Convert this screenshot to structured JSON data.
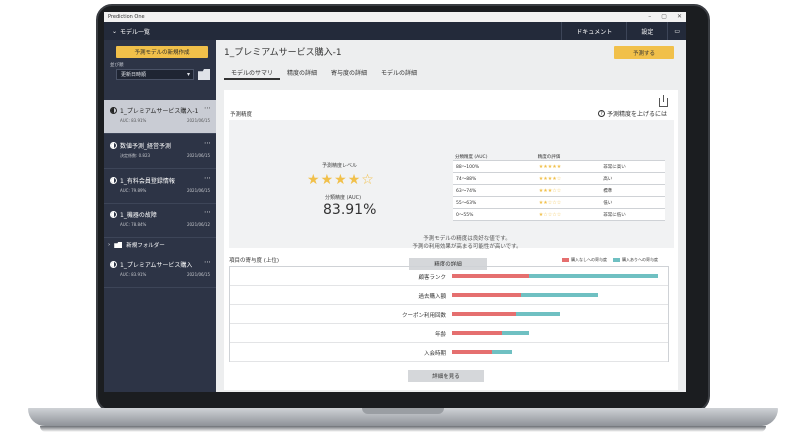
{
  "app": {
    "title": "Prediction One",
    "window_controls": [
      "–",
      "▢",
      "✕"
    ]
  },
  "menubar": {
    "models_label": "モデル一覧",
    "items": [
      "ドキュメント",
      "設定"
    ]
  },
  "sidebar": {
    "new_button": "予測モデルの新規作成",
    "sort_label": "並び順",
    "sort_value": "更新日時順",
    "models": [
      {
        "name": "1_プレミアムサービス購入-1",
        "auc": "AUC: 83.91%",
        "date": "2021/06/15"
      },
      {
        "name": "数値予測_経営予測",
        "auc": "決定係数: 0.823",
        "date": "2021/06/15"
      },
      {
        "name": "1_有料会員登録情報",
        "auc": "AUC: 79.89%",
        "date": "2021/06/15"
      },
      {
        "name": "1_機器の故障",
        "auc": "AUC: 78.84%",
        "date": "2021/06/12"
      }
    ],
    "folder_label": "新規フォルダー",
    "folder_model": {
      "name": "1_プレミアムサービス購入",
      "auc": "AUC: 83.91%",
      "date": "2021/06/15"
    }
  },
  "main": {
    "title": "1_プレミアムサービス購入-1",
    "predict_button": "予測する",
    "tabs": [
      "モデルのサマリ",
      "精度の詳細",
      "寄与度の詳細",
      "モデルの詳細"
    ],
    "accuracy_section": "予測精度",
    "help_link": "予測精度を上げるには",
    "level_label": "予測精度レベル",
    "stars_filled": 4,
    "stars_total": 5,
    "auc_label": "分類精度 (AUC)",
    "auc_value": "83.91%",
    "table": {
      "headers": [
        "分類精度 (AUC)",
        "精度の評価"
      ],
      "rows": [
        {
          "range": "88〜100%",
          "stars": "★★★★★",
          "desc": "非常に高い"
        },
        {
          "range": "74〜88%",
          "stars": "★★★★☆",
          "desc": "高い"
        },
        {
          "range": "63〜74%",
          "stars": "★★★☆☆",
          "desc": "標準"
        },
        {
          "range": "55〜63%",
          "stars": "★★☆☆☆",
          "desc": "低い"
        },
        {
          "range": "0〜55%",
          "stars": "★☆☆☆☆",
          "desc": "非常に低い"
        }
      ]
    },
    "note_line1": "予測モデルの精度は良好な値です。",
    "note_line2": "予測の利用効果が高まる可能性が高いです。",
    "detail_button": "精度の詳細",
    "contrib_title": "項目の寄与度 (上位)",
    "legend": {
      "negative": "購入なしへの寄与度",
      "positive": "購入ありへの寄与度",
      "neg_color": "#e56f6f",
      "pos_color": "#6fc0c2"
    },
    "contributions": [
      {
        "label": "顧客ランク",
        "neg": 0.37,
        "pos": 0.62
      },
      {
        "label": "過去購入額",
        "neg": 0.33,
        "pos": 0.37
      },
      {
        "label": "クーポン利用回数",
        "neg": 0.31,
        "pos": 0.21
      },
      {
        "label": "年齢",
        "neg": 0.24,
        "pos": 0.13
      },
      {
        "label": "入会時期",
        "neg": 0.19,
        "pos": 0.1
      }
    ],
    "more_button": "詳細を見る"
  }
}
